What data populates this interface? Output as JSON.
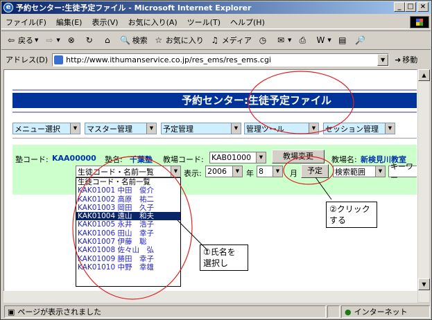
{
  "window": {
    "title": "予約センター:生徒予定ファイル - Microsoft Internet Explorer"
  },
  "menu": [
    "ファイル(F)",
    "編集(E)",
    "表示(V)",
    "お気に入り(A)",
    "ツール(T)",
    "ヘルプ(H)"
  ],
  "toolbar": {
    "back": "戻る",
    "search": "検索",
    "favorites": "お気に入り",
    "media": "メディア"
  },
  "address": {
    "label": "アドレス(D)",
    "url": "http://www.ithumanservice.co.jp/res_ems/res_ems.cgi",
    "go": "移動"
  },
  "page": {
    "title": "予約センター:生徒予定ファイル",
    "nav": [
      "メニュー選択",
      "マスター管理",
      "予定管理",
      "管理ツール",
      "セッション管理"
    ],
    "school_code_label": "塾コード:",
    "school_code": "KAA00000",
    "school_name_label": "塾名:",
    "school_name": "千葉塾",
    "classroom_code_label": "教場コード:",
    "classroom_code": "KAB01000",
    "change_classroom": "教場変更",
    "classroom_name_label": "教場名:",
    "classroom_name": "新検見川教室",
    "student_select": "生徒コード・名前一覧",
    "display_label": "表示:",
    "year": "2006",
    "year_label": "年",
    "month": "8",
    "month_label": "月",
    "schedule_button": "予定",
    "search_range": "検索範囲",
    "keyword": "キーワー"
  },
  "student_list": [
    "生徒コード・名前一覧",
    "KAK01001 中田　俊介",
    "KAK01002 高原　祐二",
    "KAK01003 岡田　久子",
    "KAK01004 遠山　和夫",
    "KAK01005 永井　浩子",
    "KAK01006 田山　幸子",
    "KAK01007 伊藤　聡",
    "KAK01008 佐々山　弘",
    "KAK01009 勝田　幸子",
    "KAK01010 中野　幸雄"
  ],
  "selected_index": 4,
  "callouts": {
    "select_name": [
      "①氏名を",
      "選択し"
    ],
    "click": [
      "②クリック",
      "する"
    ]
  },
  "status": {
    "message": "ページが表示されました",
    "zone": "インターネット"
  },
  "colors": {
    "header_bg": "#003399",
    "band_bg": "#ccffcc",
    "annotation": "#e02020"
  }
}
